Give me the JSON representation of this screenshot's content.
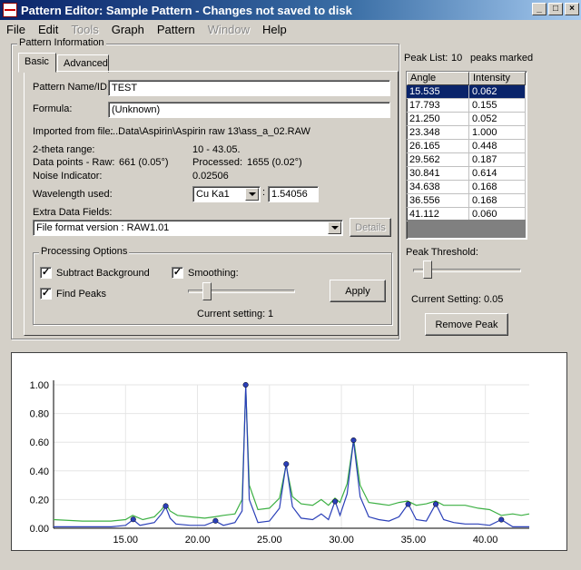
{
  "window": {
    "title": "Pattern Editor: Sample Pattern - Changes not saved to disk"
  },
  "menu": [
    "File",
    "Edit",
    "Tools",
    "Graph",
    "Pattern",
    "Window",
    "Help"
  ],
  "menu_disabled": [
    "Tools",
    "Window"
  ],
  "pattern_info": {
    "group_title": "Pattern Information",
    "tabs": [
      "Basic",
      "Advanced"
    ],
    "name_label": "Pattern Name/ID:",
    "name_value": "TEST",
    "formula_label": "Formula:",
    "formula_value": "(Unknown)",
    "imported_label": "Imported from file:",
    "imported_value": "...Data\\Aspirin\\Aspirin raw 13\\ass_a_02.RAW",
    "two_theta_label": "2-theta range:",
    "two_theta_value": "10  - 43.05.",
    "data_points_label": "Data points - Raw:",
    "data_points_raw": "661 (0.05°)",
    "processed_label": "Processed:",
    "processed_value": "1655 (0.02°)",
    "noise_label": "Noise Indicator:",
    "noise_value": "0.02506",
    "wavelength_label": "Wavelength used:",
    "wavelength_select": "Cu Ka1",
    "wavelength_value": "1.54056",
    "extra_label": "Extra Data Fields:",
    "extra_value": "File format version : RAW1.01",
    "details_button": "Details",
    "processing": {
      "title": "Processing Options",
      "subtract_background": "Subtract Background",
      "find_peaks": "Find Peaks",
      "smoothing": "Smoothing:",
      "current_setting_label": "Current setting:",
      "current_setting_value": "1",
      "apply_button": "Apply",
      "slider_fraction": 0.15
    }
  },
  "peak_list": {
    "label": "Peak List:",
    "count": "10",
    "suffix": "peaks marked",
    "headers": [
      "Angle",
      "Intensity"
    ],
    "rows": [
      [
        "15.535",
        "0.062"
      ],
      [
        "17.793",
        "0.155"
      ],
      [
        "21.250",
        "0.052"
      ],
      [
        "23.348",
        "1.000"
      ],
      [
        "26.165",
        "0.448"
      ],
      [
        "29.562",
        "0.187"
      ],
      [
        "30.841",
        "0.614"
      ],
      [
        "34.638",
        "0.168"
      ],
      [
        "36.556",
        "0.168"
      ],
      [
        "41.112",
        "0.060"
      ]
    ],
    "selected_index": 0,
    "threshold_label": "Peak Threshold:",
    "threshold_fraction": 0.1,
    "current_setting_label": "Current Setting:",
    "current_setting_value": "0.05",
    "remove_button": "Remove Peak"
  },
  "chart_data": {
    "type": "line",
    "xlim": [
      10,
      43.05
    ],
    "ylim": [
      0,
      1.0
    ],
    "x_ticks": [
      15,
      20,
      25,
      30,
      35,
      40
    ],
    "x_tick_labels": [
      "15.00",
      "20.00",
      "25.00",
      "30.00",
      "35.00",
      "40.00"
    ],
    "y_ticks": [
      0,
      0.2,
      0.4,
      0.6,
      0.8,
      1.0
    ],
    "y_tick_labels": [
      "0.00",
      "0.20",
      "0.40",
      "0.60",
      "0.80",
      "1.00"
    ],
    "grid": true,
    "series": [
      {
        "color": "#3cb043",
        "x": [
          10,
          12,
          14,
          15.0,
          15.5,
          16.2,
          17.0,
          17.5,
          17.8,
          18.1,
          18.6,
          19.5,
          20.5,
          21.2,
          21.8,
          22.6,
          23.1,
          23.35,
          23.6,
          24.2,
          25.0,
          25.7,
          26.15,
          26.6,
          27.2,
          28.0,
          28.6,
          29.1,
          29.55,
          29.9,
          30.4,
          30.85,
          31.3,
          31.9,
          32.6,
          33.3,
          34.0,
          34.6,
          35.2,
          35.9,
          36.55,
          37.1,
          37.8,
          38.6,
          39.5,
          40.3,
          41.1,
          41.9,
          42.5,
          43.05
        ],
        "y": [
          0.06,
          0.05,
          0.05,
          0.06,
          0.09,
          0.06,
          0.08,
          0.13,
          0.17,
          0.12,
          0.09,
          0.08,
          0.07,
          0.08,
          0.09,
          0.1,
          0.2,
          0.98,
          0.3,
          0.13,
          0.14,
          0.21,
          0.44,
          0.22,
          0.17,
          0.16,
          0.2,
          0.16,
          0.21,
          0.18,
          0.31,
          0.62,
          0.3,
          0.18,
          0.17,
          0.16,
          0.18,
          0.19,
          0.16,
          0.17,
          0.19,
          0.16,
          0.16,
          0.16,
          0.14,
          0.13,
          0.09,
          0.1,
          0.09,
          0.1
        ]
      },
      {
        "color": "#2a3fb8",
        "x": [
          10,
          12,
          14,
          15.0,
          15.53,
          16.0,
          17.0,
          17.5,
          17.79,
          18.1,
          18.5,
          19.5,
          20.5,
          21.25,
          21.8,
          22.6,
          23.1,
          23.35,
          23.6,
          24.2,
          25.0,
          25.7,
          26.16,
          26.6,
          27.2,
          28.0,
          28.6,
          29.1,
          29.56,
          29.9,
          30.4,
          30.84,
          31.3,
          31.9,
          32.6,
          33.3,
          34.0,
          34.64,
          35.2,
          35.9,
          36.56,
          37.1,
          37.8,
          38.6,
          39.5,
          40.3,
          41.11,
          41.9,
          42.5,
          43.05
        ],
        "y": [
          0.01,
          0.01,
          0.01,
          0.02,
          0.06,
          0.02,
          0.04,
          0.1,
          0.15,
          0.07,
          0.03,
          0.02,
          0.02,
          0.05,
          0.02,
          0.04,
          0.12,
          1.0,
          0.2,
          0.04,
          0.05,
          0.14,
          0.45,
          0.15,
          0.07,
          0.06,
          0.1,
          0.06,
          0.19,
          0.09,
          0.24,
          0.61,
          0.22,
          0.08,
          0.06,
          0.05,
          0.08,
          0.17,
          0.06,
          0.05,
          0.17,
          0.06,
          0.04,
          0.03,
          0.03,
          0.02,
          0.06,
          0.01,
          0.01,
          0.01
        ]
      }
    ],
    "peaks_x": [
      15.535,
      17.793,
      21.25,
      23.348,
      26.165,
      29.562,
      30.841,
      34.638,
      36.556,
      41.112
    ],
    "peaks_y": [
      0.062,
      0.155,
      0.052,
      1.0,
      0.448,
      0.187,
      0.614,
      0.168,
      0.168,
      0.06
    ],
    "peak_marker_color": "#2a3fb8"
  }
}
